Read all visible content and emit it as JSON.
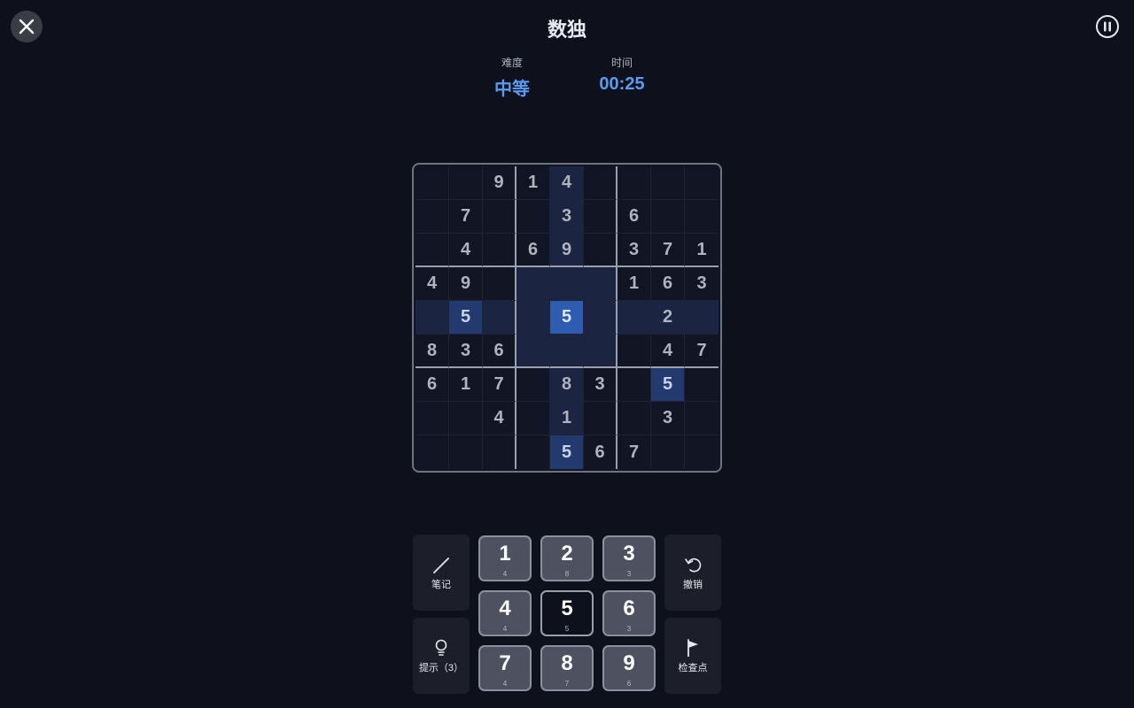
{
  "header": {
    "title": "数独",
    "difficulty_label": "难度",
    "difficulty_value": "中等",
    "time_label": "时间",
    "time_value": "00:25"
  },
  "board": [
    [
      "",
      "",
      "9",
      "1",
      "4",
      "",
      "",
      "",
      ""
    ],
    [
      "",
      "7",
      "",
      "",
      "3",
      "",
      "6",
      "",
      ""
    ],
    [
      "",
      "4",
      "",
      "6",
      "9",
      "",
      "3",
      "7",
      "1"
    ],
    [
      "4",
      "9",
      "",
      "",
      "",
      "",
      "1",
      "6",
      "3"
    ],
    [
      "",
      "5",
      "",
      "",
      "5",
      "",
      "",
      "2",
      ""
    ],
    [
      "8",
      "3",
      "6",
      "",
      "",
      "",
      "",
      "4",
      "7"
    ],
    [
      "6",
      "1",
      "7",
      "",
      "8",
      "3",
      "",
      "5",
      ""
    ],
    [
      "",
      "",
      "4",
      "",
      "1",
      "",
      "",
      "3",
      ""
    ],
    [
      "",
      "",
      "",
      "",
      "5",
      "6",
      "7",
      "",
      ""
    ]
  ],
  "selected_cell": {
    "row": 4,
    "col": 4
  },
  "highlight_value": "5",
  "numpad": [
    {
      "label": "1",
      "count": "4"
    },
    {
      "label": "2",
      "count": "8"
    },
    {
      "label": "3",
      "count": "3"
    },
    {
      "label": "4",
      "count": "4"
    },
    {
      "label": "5",
      "count": "5",
      "active": true
    },
    {
      "label": "6",
      "count": "3"
    },
    {
      "label": "7",
      "count": "4"
    },
    {
      "label": "8",
      "count": "7"
    },
    {
      "label": "9",
      "count": "6"
    }
  ],
  "actions": {
    "notes_label": "笔记",
    "hint_label": "提示（3）",
    "undo_label": "撤销",
    "checkpoint_label": "检查点"
  },
  "icons": [
    "close-icon",
    "pause-icon",
    "pencil-icon",
    "lightbulb-icon",
    "undo-icon",
    "flag-icon"
  ],
  "colors": {
    "accent": "#5b9cf0",
    "selected": "#2e5cb0",
    "background": "#0e101c"
  }
}
